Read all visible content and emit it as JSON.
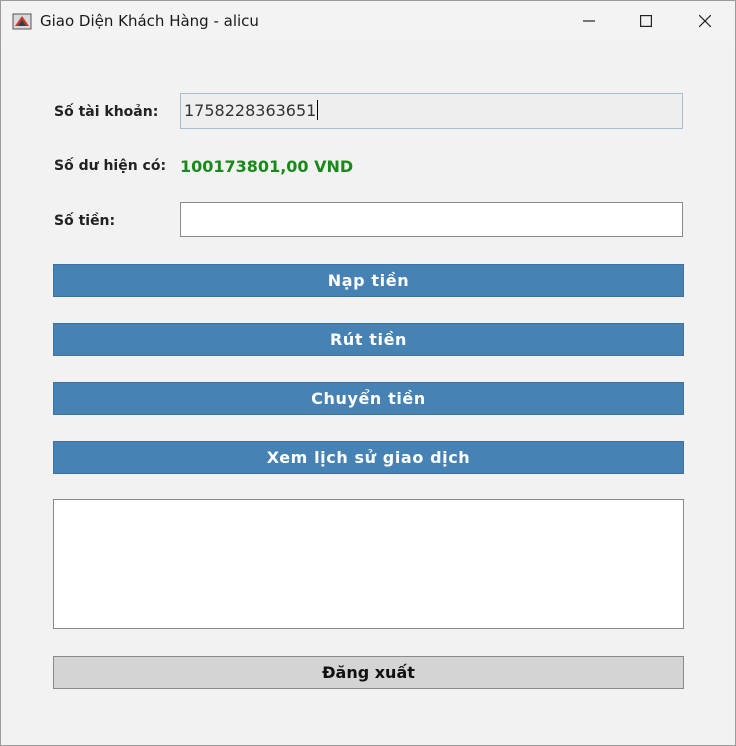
{
  "window": {
    "title": "Giao Diện Khách Hàng - alicu"
  },
  "form": {
    "account_label": "Số tài khoản:",
    "account_value": "1758228363651",
    "balance_label": "Số dư hiện có:",
    "balance_value": "100173801,00 VND",
    "amount_label": "Số tiền:",
    "amount_value": ""
  },
  "actions": {
    "deposit": "Nạp tiền",
    "withdraw": "Rút tiền",
    "transfer": "Chuyển tiền",
    "history": "Xem lịch sử giao dịch",
    "logout": "Đăng xuất"
  },
  "colors": {
    "button_blue": "#4682b4",
    "balance_green": "#198a19",
    "logout_gray": "#d4d4d4"
  },
  "icons": {
    "app": "java-app-icon",
    "minimize": "minimize-icon",
    "maximize": "maximize-icon",
    "close": "close-icon"
  }
}
